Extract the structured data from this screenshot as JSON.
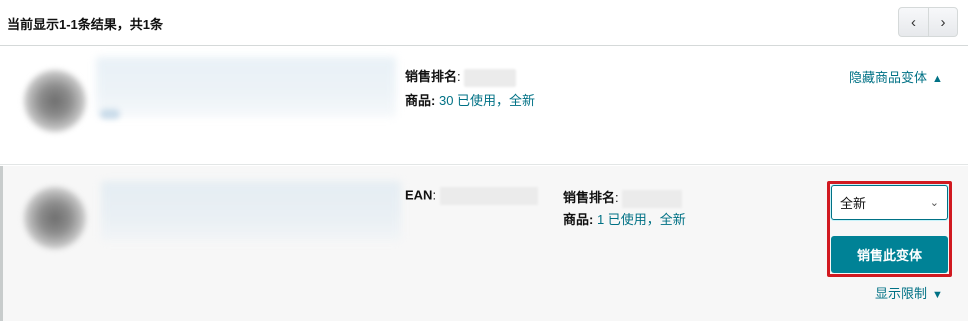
{
  "header": {
    "result_text": "当前显示1-1条结果，共1条",
    "prev_label": "‹",
    "next_label": "›"
  },
  "rows": [
    {
      "sales_rank_label": "销售排名",
      "sales_rank_sep": ":",
      "offers_label": "商品:",
      "offers_value": "30 已使用，全新",
      "toggle_label": "隐藏商品变体",
      "toggle_icon": "chevron-up-icon"
    },
    {
      "ean_label": "EAN",
      "ean_sep": ":",
      "sales_rank_label": "销售排名",
      "sales_rank_sep": ":",
      "offers_label": "商品:",
      "offers_value": "1 已使用，全新",
      "condition_selected": "全新",
      "sell_button_label": "销售此变体",
      "toggle_label": "显示限制",
      "toggle_icon": "chevron-down-icon"
    }
  ],
  "colors": {
    "link": "#007185",
    "button": "#008296",
    "highlight": "#d11920"
  }
}
